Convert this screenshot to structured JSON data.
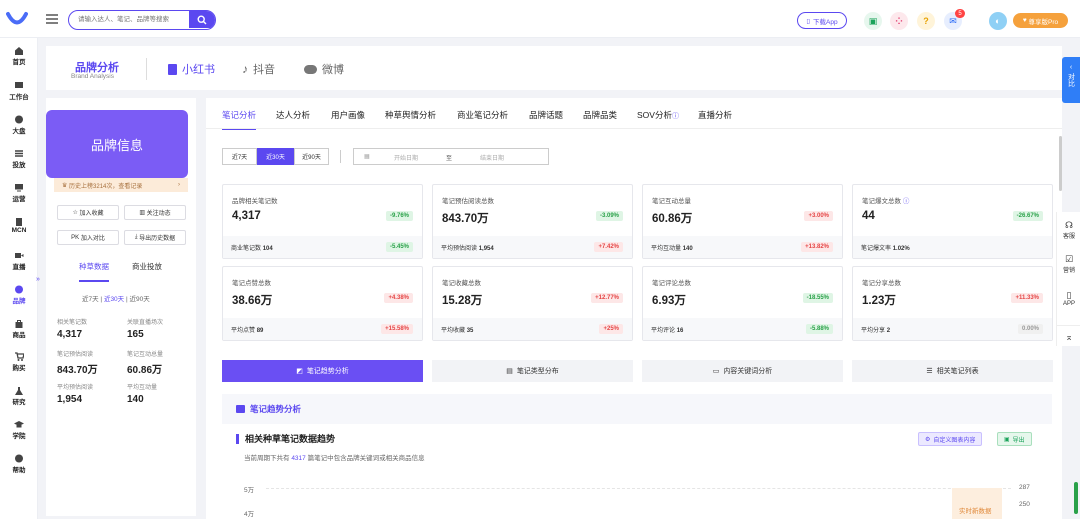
{
  "topbar": {
    "search_placeholder": "请输入达人、笔记、品牌等搜索",
    "download": "下载App",
    "notif_count": "5",
    "pro": "尊享版Pro"
  },
  "sidebar": [
    {
      "label": "首页",
      "icon": "home-icon"
    },
    {
      "label": "工作台",
      "icon": "desk-icon"
    },
    {
      "label": "大盘",
      "icon": "pie-icon"
    },
    {
      "label": "投放",
      "icon": "list-icon"
    },
    {
      "label": "运营",
      "icon": "monitor-icon"
    },
    {
      "label": "MCN",
      "icon": "building-icon"
    },
    {
      "label": "直播",
      "icon": "video-icon"
    },
    {
      "label": "品牌",
      "icon": "brand-icon"
    },
    {
      "label": "商品",
      "icon": "bag-icon"
    },
    {
      "label": "购买",
      "icon": "cart-icon"
    },
    {
      "label": "研究",
      "icon": "flask-icon"
    },
    {
      "label": "学院",
      "icon": "cap-icon"
    },
    {
      "label": "帮助",
      "icon": "help-icon"
    }
  ],
  "header": {
    "title": "品牌分析",
    "subtitle": "Brand Analysis",
    "platforms": [
      "小红书",
      "抖音",
      "微博"
    ]
  },
  "left": {
    "brand_info": "品牌信息",
    "history": "历史上榜3214次，查看记录",
    "buttons": [
      "加入收藏",
      "关注动态",
      "加入对比",
      "导出历史数据"
    ],
    "tabs": [
      "种草数据",
      "商业投放"
    ],
    "range_opts": [
      "近7天",
      "近30天",
      "近90天"
    ],
    "stats": [
      {
        "label": "相关笔记数",
        "value": "4,317"
      },
      {
        "label": "关联直播场次",
        "value": "165"
      },
      {
        "label": "笔记预估阅读",
        "value": "843.70万"
      },
      {
        "label": "笔记互动总量",
        "value": "60.86万"
      },
      {
        "label": "平均预估阅读",
        "value": "1,954"
      },
      {
        "label": "平均互动量",
        "value": "140"
      }
    ]
  },
  "main": {
    "tabs": [
      "笔记分析",
      "达人分析",
      "用户画像",
      "种草舆情分析",
      "商业笔记分析",
      "品牌话题",
      "品牌品类",
      "SOV分析",
      "直播分析"
    ],
    "range": [
      "近7天",
      "近30天",
      "近90天"
    ],
    "date_start": "开始日期",
    "date_sep": "至",
    "date_end": "结束日期",
    "cards": [
      {
        "label": "品牌相关笔记数",
        "value": "4,317",
        "chg": "-9.76%",
        "dir": "down",
        "sub": "商业笔记数",
        "subval": "104",
        "subchg": "-5.45%",
        "subdir": "down"
      },
      {
        "label": "笔记预估阅读总数",
        "value": "843.70万",
        "chg": "-3.09%",
        "dir": "down",
        "sub": "平均预估阅读",
        "subval": "1,954",
        "subchg": "+7.42%",
        "subdir": "up"
      },
      {
        "label": "笔记互动总量",
        "value": "60.86万",
        "chg": "+3.00%",
        "dir": "up",
        "sub": "平均互动量",
        "subval": "140",
        "subchg": "+13.82%",
        "subdir": "up"
      },
      {
        "label": "笔记爆文总数",
        "value": "44",
        "chg": "-26.67%",
        "dir": "down",
        "sub": "笔记爆文率",
        "subval": "1.02%",
        "subchg": "",
        "subdir": ""
      },
      {
        "label": "笔记点赞总数",
        "value": "38.66万",
        "chg": "+4.38%",
        "dir": "up",
        "sub": "平均点赞",
        "subval": "89",
        "subchg": "+15.58%",
        "subdir": "up"
      },
      {
        "label": "笔记收藏总数",
        "value": "15.28万",
        "chg": "+12.77%",
        "dir": "up",
        "sub": "平均收藏",
        "subval": "35",
        "subchg": "+25%",
        "subdir": "up"
      },
      {
        "label": "笔记评论总数",
        "value": "6.93万",
        "chg": "-18.55%",
        "dir": "down",
        "sub": "平均评论",
        "subval": "16",
        "subchg": "-5.88%",
        "subdir": "down"
      },
      {
        "label": "笔记分享总数",
        "value": "1.23万",
        "chg": "+11.33%",
        "dir": "up",
        "sub": "平均分享",
        "subval": "2",
        "subchg": "0.00%",
        "subdir": "zero"
      }
    ],
    "btabs": [
      "笔记趋势分析",
      "笔记类型分布",
      "内容关键词分析",
      "相关笔记列表"
    ],
    "panel": {
      "head": "笔记趋势分析",
      "title": "相关种草笔记数据趋势",
      "sub_pre": "当前周期下共有",
      "sub_num": "4317",
      "sub_post": "篇笔记中包含品牌关键词或相关商品信息",
      "custom": "自定义图表内容",
      "export": "导出",
      "y_left": [
        "5万",
        "4万"
      ],
      "y_right": [
        "287",
        "250"
      ],
      "realtime": "实时新数据"
    }
  },
  "right": [
    "客服",
    "营销",
    "APP"
  ],
  "compare": "对比"
}
